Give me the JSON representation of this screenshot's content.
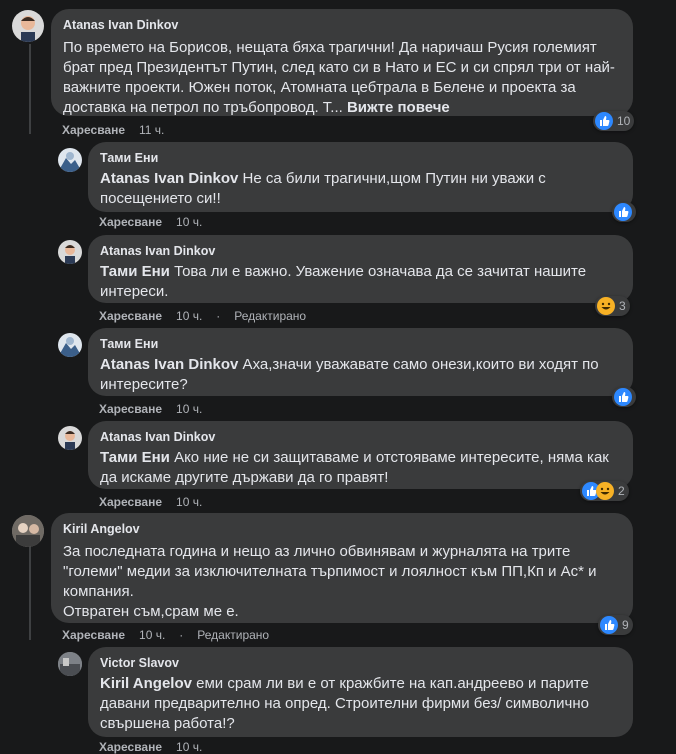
{
  "common": {
    "like": "Харесване",
    "edited": "Редактирано",
    "see_more": "Вижте повече"
  },
  "comments": [
    {
      "author": "Atanas Ivan Dinkov",
      "mention": "",
      "text": "По времето на Борисов, нещата бяха трагични! Да наричаш Русия големият брат пред Президентът Путин, след като си в Нато и ЕС и си спрял три от най-важните проекти. Южен поток, Атомната цебтрала в Белене и проекта за доставка на петрол по тръбопровод. Т...",
      "time": "11 ч.",
      "reactions": "10"
    },
    {
      "author": "Тами Ени",
      "mention": "Atanas Ivan Dinkov",
      "text": " Не са били трагични,щом Путин ни уважи с посещението си!!",
      "time": "10 ч.",
      "reactions": ""
    },
    {
      "author": "Atanas Ivan Dinkov",
      "mention": "Тами Ени",
      "text": " Това ли е важно. Уважение означава да се зачитат нашите интереси.",
      "time": "10 ч.",
      "reactions": "3"
    },
    {
      "author": "Тами Ени",
      "mention": "Atanas Ivan Dinkov",
      "text": " Аха,значи уважавате само онези,които ви ходят по интересите?",
      "time": "10 ч.",
      "reactions": ""
    },
    {
      "author": "Atanas Ivan Dinkov",
      "mention": "Тами Ени",
      "text": " Ако ние не си защитаваме и отстояваме интересите, няма как да искаме другите държави да го правят!",
      "time": "10 ч.",
      "reactions": "2"
    },
    {
      "author": "Kiril Angelov",
      "mention": "",
      "text": "За последната година и нещо аз лично обвинявам и журналята на трите \"големи\" медии за изключителната търпимост и лоялност към ПП,Кп и Ас* и компания.",
      "text2": "Отвратен съм,срам ме е.",
      "time": "10 ч.",
      "reactions": "9"
    },
    {
      "author": "Victor Slavov",
      "mention": "Kiril Angelov",
      "text": " еми срам ли ви е от кражбите на кап.андреево и парите давани предварително на опред. Строителни фирми без/ символично свършена работа!?",
      "time": "10 ч.",
      "reactions": ""
    }
  ],
  "colors": {
    "bubble": "#3a3b3c",
    "background": "#18191a",
    "like_blue": "#2d88ff",
    "haha_yellow": "#f7b125"
  }
}
